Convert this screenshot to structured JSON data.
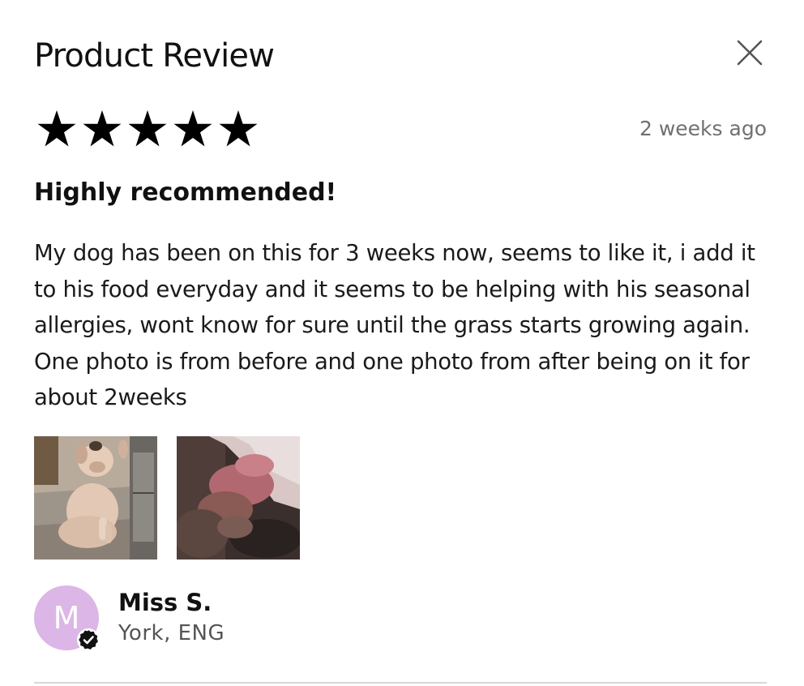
{
  "modal": {
    "title": "Product Review",
    "close_icon": "close-icon"
  },
  "review": {
    "rating": 5,
    "max_rating": 5,
    "date": "2 weeks ago",
    "title": "Highly recommended!",
    "body": "My dog has been on this for 3 weeks now, seems to like it, i add it to his food everyday and it seems to be helping with his seasonal allergies, wont know for sure until the grass starts growing again. One photo is from before and one photo from after being on it for about 2weeks",
    "photos": [
      {
        "icon": "dog-photo-before"
      },
      {
        "icon": "dog-photo-after"
      }
    ]
  },
  "author": {
    "initial": "M",
    "name": "Miss S.",
    "location": "York, ENG",
    "avatar_color": "#dcb6e6",
    "verified_icon": "verified-badge-icon"
  },
  "colors": {
    "text": "#111111",
    "muted": "#707070",
    "divider": "#d8d8d8"
  }
}
